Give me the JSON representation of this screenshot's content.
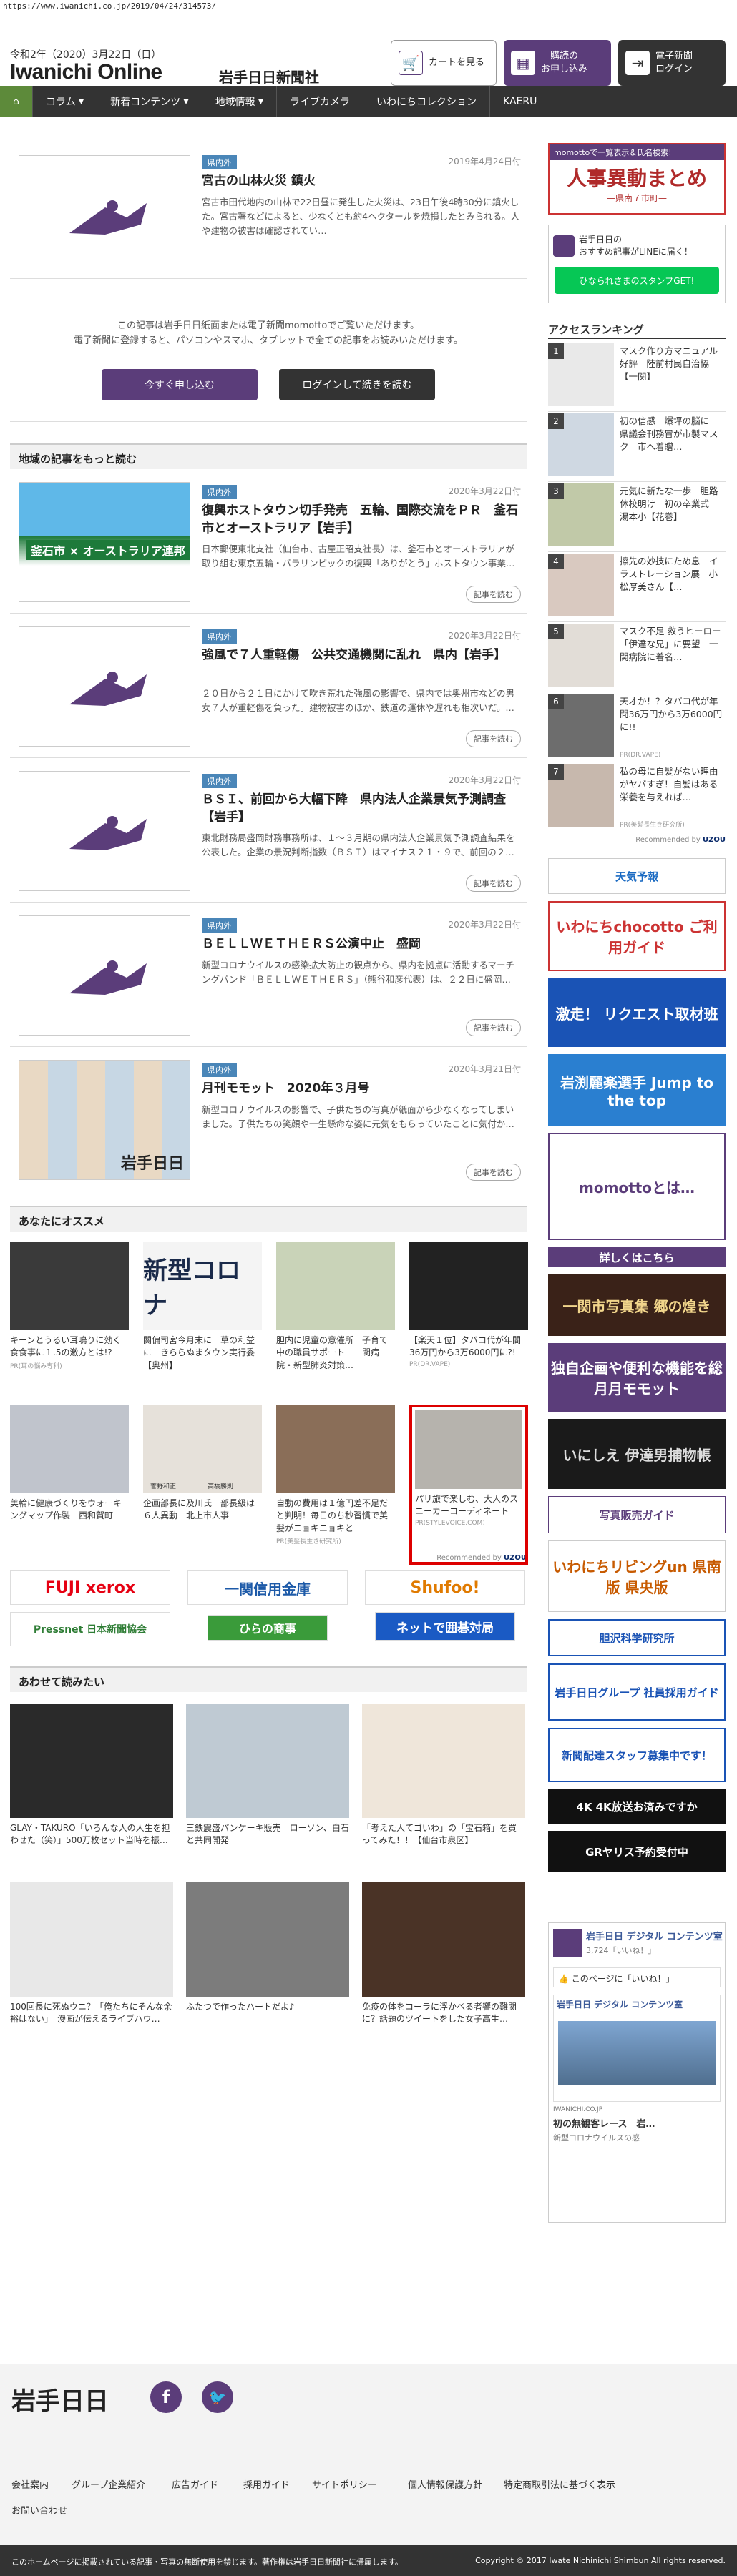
{
  "url": "https://www.iwanichi.co.jp/2019/04/24/314573/",
  "header": {
    "date": "令和2年（2020）3月22日（日）",
    "logo": "Iwanichi Online",
    "logo_sub": "岩手日日新聞社",
    "cart": "カートを見る",
    "subscribe": "購読の\nお申し込み",
    "login": "電子新聞\nログイン"
  },
  "nav": [
    "コラム",
    "新着コンテンツ",
    "地域情報",
    "ライブカメラ",
    "いわにちコレクション",
    "KAERU"
  ],
  "top_article": {
    "tag": "県内外",
    "date": "2019年4月24日付",
    "title": "宮古の山林火災 鎮火",
    "body": "宮古市田代地内の山林で22日昼に発生した火災は、23日午後4時30分に鎮火した。宮古署などによると、少なくとも約4ヘクタールを焼損したとみられる。人や建物の被害は確認されてい…"
  },
  "paywall": {
    "text1": "この記事は岩手日日紙面または電子新聞momottoでご覧いただけます。",
    "text2": "電子新聞に登録すると、パソコンやスマホ、タブレットで全ての記事をお読みいただけます。",
    "btn1": "今すぐ申し込む",
    "btn2": "ログインして続きを読む"
  },
  "local": {
    "heading": "地域の記事をもっと読む",
    "more": "記事を読む",
    "thumb_caption": "釜石市 × オーストラリア連邦",
    "articles": [
      {
        "tag": "県内外",
        "date": "2020年3月22日付",
        "title": "復興ホストタウン切手発売　五輪、国際交流をＰＲ　釜石市とオーストラリア【岩手】",
        "body": "日本郵便東北支社（仙台市、古屋正昭支社長）は、釜石市とオーストラリアが取り組む東京五輪・パラリンピックの復興「ありがとう」ホストタウン事業…"
      },
      {
        "tag": "県内外",
        "date": "2020年3月22日付",
        "title": "強風で７人重軽傷　公共交通機関に乱れ　県内【岩手】",
        "body": "２０日から２１日にかけて吹き荒れた強風の影響で、県内では奥州市などの男女７人が重軽傷を負った。建物被害のほか、鉄道の運休や遅れも相次いだ。…"
      },
      {
        "tag": "県内外",
        "date": "2020年3月22日付",
        "title": "ＢＳＩ、前回から大幅下降　県内法人企業景気予測調査【岩手】",
        "body": "東北財務局盛岡財務事務所は、１～３月期の県内法人企業景気予測調査結果を公表した。企業の景況判断指数（ＢＳＩ）はマイナス２１・９で、前回の２…"
      },
      {
        "tag": "県内外",
        "date": "2020年3月22日付",
        "title": "ＢＥＬＬＷＥＴＨＥＲＳ公演中止　盛岡",
        "body": "新型コロナウイルスの感染拡大防止の観点から、県内を拠点に活動するマーチングバンド「ＢＥＬＬＷＥＴＨＥＲＳ」（熊谷和彦代表）は、２２日に盛岡…"
      },
      {
        "tag": "県内外",
        "date": "2020年3月21日付",
        "title": "月刊モモット　2020年３月号",
        "body": "新型コロナウイルスの影響で、子供たちの写真が紙面から少なくなってしまいました。子供たちの笑顔や一生懸命な姿に元気をもらっていたことに気付か…",
        "thumb_text": "岩手日日"
      }
    ]
  },
  "recommend": {
    "heading": "あなたにオススメ",
    "recommended_by": "Recommended by",
    "img_text": "新型コロナ",
    "items": [
      {
        "t": "キーンとうるい耳鳴りに効く食食事に１.5の激方とは!?",
        "p": "PR(耳の悩み専科)"
      },
      {
        "t": "関偏司宮今月末に　草の利益に　きららぬまタウン実行委【奥州】",
        "p": ""
      },
      {
        "t": "胆内に児童の意催所　子育て中の職員サポート　一関病院・新型肺炎対策…",
        "p": ""
      },
      {
        "t": "【楽天１位】タバコ代が年間36万円から3万6000円に?!",
        "p": "PR(DR.VAPE)"
      },
      {
        "t": "美輪に健康づくりをウォーキングマップ作製　西和賀町",
        "p": ""
      },
      {
        "t": "企画部長に及川氏　部長級は６人異動　北上市人事",
        "p": ""
      },
      {
        "t": "自動の費用は１億円差不足だと判明！毎日のち秒習慣で美髪がニョキニョキと",
        "p": "PR(美髪長生き研究所)"
      },
      {
        "t": "パリ旅で楽しむ、大人のスニーカーコーディネート",
        "p": "PR(STYLEVOICE.COM)"
      }
    ],
    "captions": [
      "菅野和正",
      "高橋勝則"
    ]
  },
  "logos": [
    "FUJI xerox",
    "一関信用金庫",
    "Shufoo!",
    "Pressnet 日本新聞協会",
    "ひらの商事",
    "ネットで囲碁対局"
  ],
  "also": {
    "heading": "あわせて読みたい",
    "items": [
      {
        "t": "GLAY・TAKURO「いろんな人の人生を担わせた（笑）」500万枚セット当時を振…"
      },
      {
        "t": "三鉄震盛パンケーキ販売　ローソン、白石と共同開発"
      },
      {
        "t": "「考えた人てゴいわ」の「宝石箱」を買ってみた！！【仙台市泉区】"
      },
      {
        "t": "100回長に死ぬウニ？「俺たちにそんな余裕はない」　漫画が伝えるライブハウ…"
      },
      {
        "t": "ふたつで作ったハートだよ♪"
      },
      {
        "t": "免疫の体をコーラに浮かべる者響の難関に？話題のツイートをした女子高生…"
      }
    ]
  },
  "sidebar": {
    "momotto_banner": "momottoで一覧表示＆氏名検索!",
    "jinji": "人事異動まとめ",
    "jinji_sub": "—県南７市町—",
    "line_title": "岩手日日の\nおすすめ記事がLINEに届く！",
    "line_btn": "ひなられさまのスタンプGET!",
    "ranking_heading": "アクセスランキング",
    "ranking": [
      {
        "n": "1",
        "t": "マスク作り方マニュアル好評　陸前村民自治協【一関】"
      },
      {
        "n": "2",
        "t": "初の信感　爆坪の脳に　県議会刊務冒が市製マスク　市へ着贈…"
      },
      {
        "n": "3",
        "t": "元気に新たな一歩　胆路休校明け　初の卒業式　湯本小【花巻】"
      },
      {
        "n": "4",
        "t": "擦先の妙技にため息　イラストレーション展　小松厚美さん【…"
      },
      {
        "n": "5",
        "t": "マスク不足 救うヒーロー「伊達な兄」に要望　一関病院に着名…"
      },
      {
        "n": "6",
        "t": "天才か！？タバコ代が年間36万円から3万6000円に!!",
        "p": "PR(DR.VAPE)"
      },
      {
        "n": "7",
        "t": "私の母に自髪がない理由がヤバすぎ！自髪はある栄養を与えれば…",
        "p": "PR(美髪長生き研究所)"
      }
    ],
    "recommended_by": "Recommended by",
    "banners": [
      "天気予報",
      "いわにちchocotto ご利用ガイド",
      "激走！ リクエスト取材班",
      "岩渕麗楽選手 Jump to the top",
      "momottoとは…",
      "詳しくはこちら",
      "一関市写真集 郷の煌き",
      "独自企画や便利な機能を総月月モモット",
      "いにしえ 伊達男捕物帳",
      "写真販売ガイド",
      "いわにちリビングun 県南版 県央版",
      "胆沢科学研究所",
      "岩手日日グループ 社員採用ガイド",
      "新聞配達スタッフ募集中です！",
      "4K 4K放送お済みですか",
      "GRヤリス予約受付中"
    ],
    "fb_name": "岩手日日 デジタル コンテンツ室",
    "fb_likes": "3,724「いいね！」",
    "fb_box_title": "このページに「いいね！」",
    "fb_post_title": "初の無観客レース　岩…",
    "fb_post_sub": "新型コロナウイルスの感",
    "fb_source": "IWANICHI.CO.JP"
  },
  "footer": {
    "logo": "岩手日日",
    "links": [
      "会社案内",
      "グループ企業紹介",
      "広告ガイド",
      "採用ガイド",
      "サイトポリシー",
      "個人情報保護方針",
      "特定商取引法に基づく表示",
      "お問い合わせ"
    ],
    "note": "このホームページに掲載されている記事・写真の無断使用を禁じます。著作権は岩手日日新聞社に帰属します。",
    "copyright": "Copyright © 2017 Iwate Nichinichi Shimbun All rights reserved."
  },
  "colors": {
    "purple": "#5b3d7a",
    "nav": "#333333",
    "tag": "#4a86b8",
    "green": "#5d8a3a"
  }
}
